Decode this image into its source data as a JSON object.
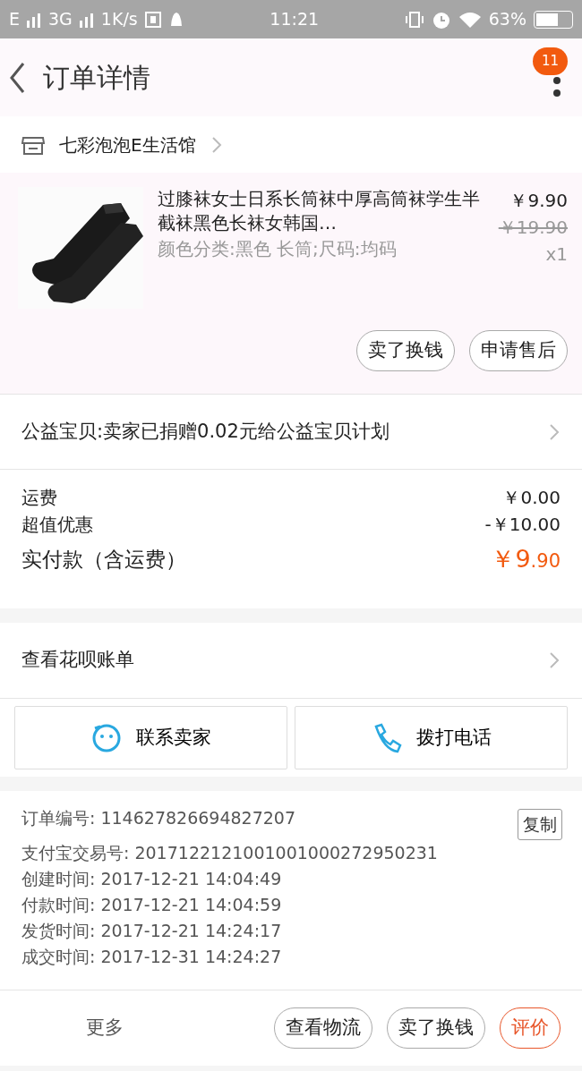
{
  "status_bar": {
    "network": "E",
    "network2": "3G",
    "speed": "1K/s",
    "time": "11:21",
    "battery": "63%"
  },
  "header": {
    "title": "订单详情",
    "badge": "11"
  },
  "shop": {
    "name": "七彩泡泡E生活馆"
  },
  "product": {
    "kind": "picture",
    "title": "过膝袜女士日系长筒袜中厚高筒袜学生半截袜黑色长袜女韩国…",
    "spec": "颜色分类:黑色 长筒;尺码:均码",
    "price": "￥9.90",
    "original_price": "￥19.90",
    "quantity": "x1",
    "buttons": [
      "卖了换钱",
      "申请售后"
    ]
  },
  "charity": {
    "text": "公益宝贝:卖家已捐赠0.02元给公益宝贝计划"
  },
  "fees": [
    {
      "kind": "normal",
      "label": "运费",
      "value": "￥0.00"
    },
    {
      "kind": "normal",
      "label": "超值优惠",
      "value": "-￥10.00"
    },
    {
      "kind": "total",
      "label": "实付款（含运费）",
      "value": "￥9",
      "value_small": ".90"
    }
  ],
  "huabei": {
    "text": "查看花呗账单"
  },
  "contact": [
    {
      "kind": "chat",
      "label": "联系卖家"
    },
    {
      "kind": "phone",
      "label": "拨打电话"
    }
  ],
  "order_info": {
    "copy_button": "复制",
    "lines": [
      "订单编号: 114627826694827207",
      "支付宝交易号: 2017122121001001000272950231",
      "创建时间: 2017-12-21 14:04:49",
      "付款时间: 2017-12-21 14:04:59",
      "发货时间: 2017-12-21 14:24:17",
      "成交时间: 2017-12-31 14:24:27"
    ]
  },
  "bottom_bar": {
    "more": "更多",
    "buttons": [
      {
        "label": "查看物流",
        "primary": false
      },
      {
        "label": "卖了换钱",
        "primary": false
      },
      {
        "label": "评价",
        "primary": true
      }
    ]
  }
}
